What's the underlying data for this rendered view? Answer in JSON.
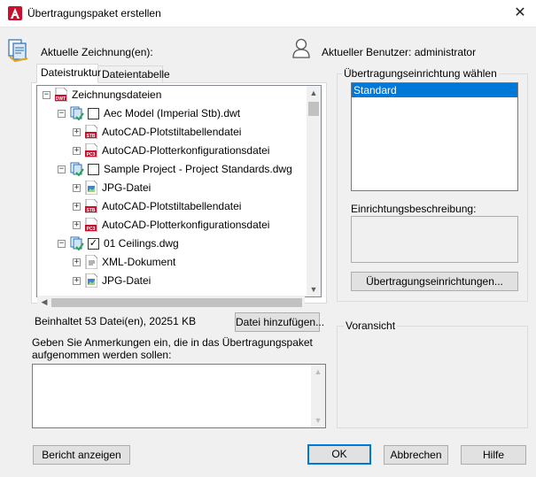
{
  "window": {
    "title": "Übertragungspaket erstellen",
    "close": "✕"
  },
  "header": {
    "current_drawings_label": "Aktuelle Zeichnung(en):",
    "current_user_label": "Aktueller Benutzer: administrator"
  },
  "tabs": [
    {
      "label": "Dateistruktur",
      "active": true
    },
    {
      "label": "Dateientabelle",
      "active": false
    }
  ],
  "tree": [
    {
      "label": "Zeichnungsdateien",
      "expander": "-",
      "icon": "dwt-file-icon",
      "checkbox": null
    },
    {
      "label": "Aec Model (Imperial Stb).dwt",
      "expander": "-",
      "icon": "drawing-set-icon",
      "checkbox": false
    },
    {
      "label": "AutoCAD-Plotstiltabellendatei",
      "expander": "+",
      "icon": "stb-file-icon",
      "checkbox": null
    },
    {
      "label": "AutoCAD-Plotterkonfigurationsdatei",
      "expander": "+",
      "icon": "pc3-file-icon",
      "checkbox": null
    },
    {
      "label": "Sample Project - Project Standards.dwg",
      "expander": "-",
      "icon": "drawing-set-icon",
      "checkbox": false
    },
    {
      "label": "JPG-Datei",
      "expander": "+",
      "icon": "jpg-file-icon",
      "checkbox": null
    },
    {
      "label": "AutoCAD-Plotstiltabellendatei",
      "expander": "+",
      "icon": "stb-file-icon",
      "checkbox": null
    },
    {
      "label": "AutoCAD-Plotterkonfigurationsdatei",
      "expander": "+",
      "icon": "pc3-file-icon",
      "checkbox": null
    },
    {
      "label": "01 Ceilings.dwg",
      "expander": "-",
      "icon": "drawing-set-icon",
      "checkbox": true
    },
    {
      "label": "XML-Dokument",
      "expander": "+",
      "icon": "xml-file-icon",
      "checkbox": null
    },
    {
      "label": "JPG-Datei",
      "expander": "+",
      "icon": "jpg-file-icon",
      "checkbox": null
    }
  ],
  "file_summary": "Beinhaltet 53 Datei(en), 20251 KB",
  "add_file_button": "Datei hinzufügen...",
  "notes": {
    "label_line1": "Geben Sie Anmerkungen ein, die in das Übertragungspaket",
    "label_line2": "aufgenommen werden sollen:",
    "value": ""
  },
  "setup_group": {
    "label": "Übertragungseinrichtung wählen",
    "items": [
      "Standard"
    ],
    "selected": "Standard",
    "description_label": "Einrichtungsbeschreibung:",
    "description_value": "",
    "setups_button": "Übertragungseinrichtungen..."
  },
  "preview_group": {
    "label": "Voransicht"
  },
  "buttons": {
    "report": "Bericht anzeigen",
    "ok": "OK",
    "cancel": "Abbrechen",
    "help": "Hilfe"
  },
  "colors": {
    "accent": "#0078d7",
    "autocad_red": "#c8102e"
  }
}
